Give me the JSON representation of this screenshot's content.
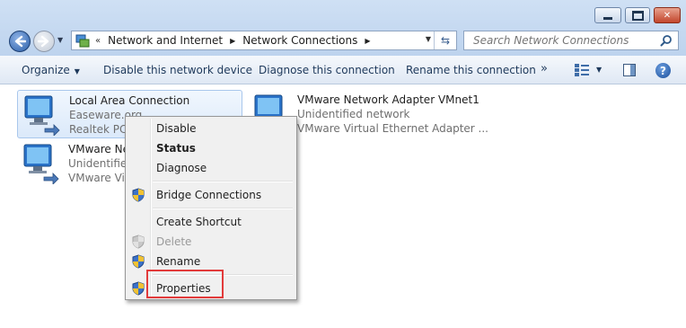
{
  "window": {
    "address_path": [
      "Network and Internet",
      "Network Connections"
    ],
    "search_placeholder": "Search Network Connections"
  },
  "toolbar": {
    "organize": "Organize",
    "disable": "Disable this network device",
    "diagnose": "Diagnose this connection",
    "rename": "Rename this connection",
    "more": "»"
  },
  "connections": [
    {
      "name": "Local Area Connection",
      "status": "Easeware.org",
      "adapter": "Realtek PCIe",
      "selected": true
    },
    {
      "name": "VMware Network Adapter VMnet1",
      "status": "Unidentified network",
      "adapter": "VMware Virtual Ethernet Adapter ...",
      "selected": false
    },
    {
      "name": "VMware Ne",
      "status": "Unidentified",
      "adapter": "VMware Vir",
      "selected": false
    }
  ],
  "context_menu": {
    "items": [
      {
        "label": "Disable",
        "icon": "",
        "state": "normal"
      },
      {
        "label": "Status",
        "icon": "",
        "state": "default"
      },
      {
        "label": "Diagnose",
        "icon": "",
        "state": "normal"
      },
      {
        "label": "Bridge Connections",
        "icon": "shield-icon",
        "state": "normal"
      },
      {
        "label": "Create Shortcut",
        "icon": "",
        "state": "normal"
      },
      {
        "label": "Delete",
        "icon": "shield-icon",
        "state": "disabled"
      },
      {
        "label": "Rename",
        "icon": "shield-icon",
        "state": "normal"
      },
      {
        "label": "Properties",
        "icon": "shield-icon",
        "state": "highlighted-red-box"
      }
    ]
  },
  "colors": {
    "accent": "#1e395b",
    "highlight_box": "#e23b3b"
  }
}
